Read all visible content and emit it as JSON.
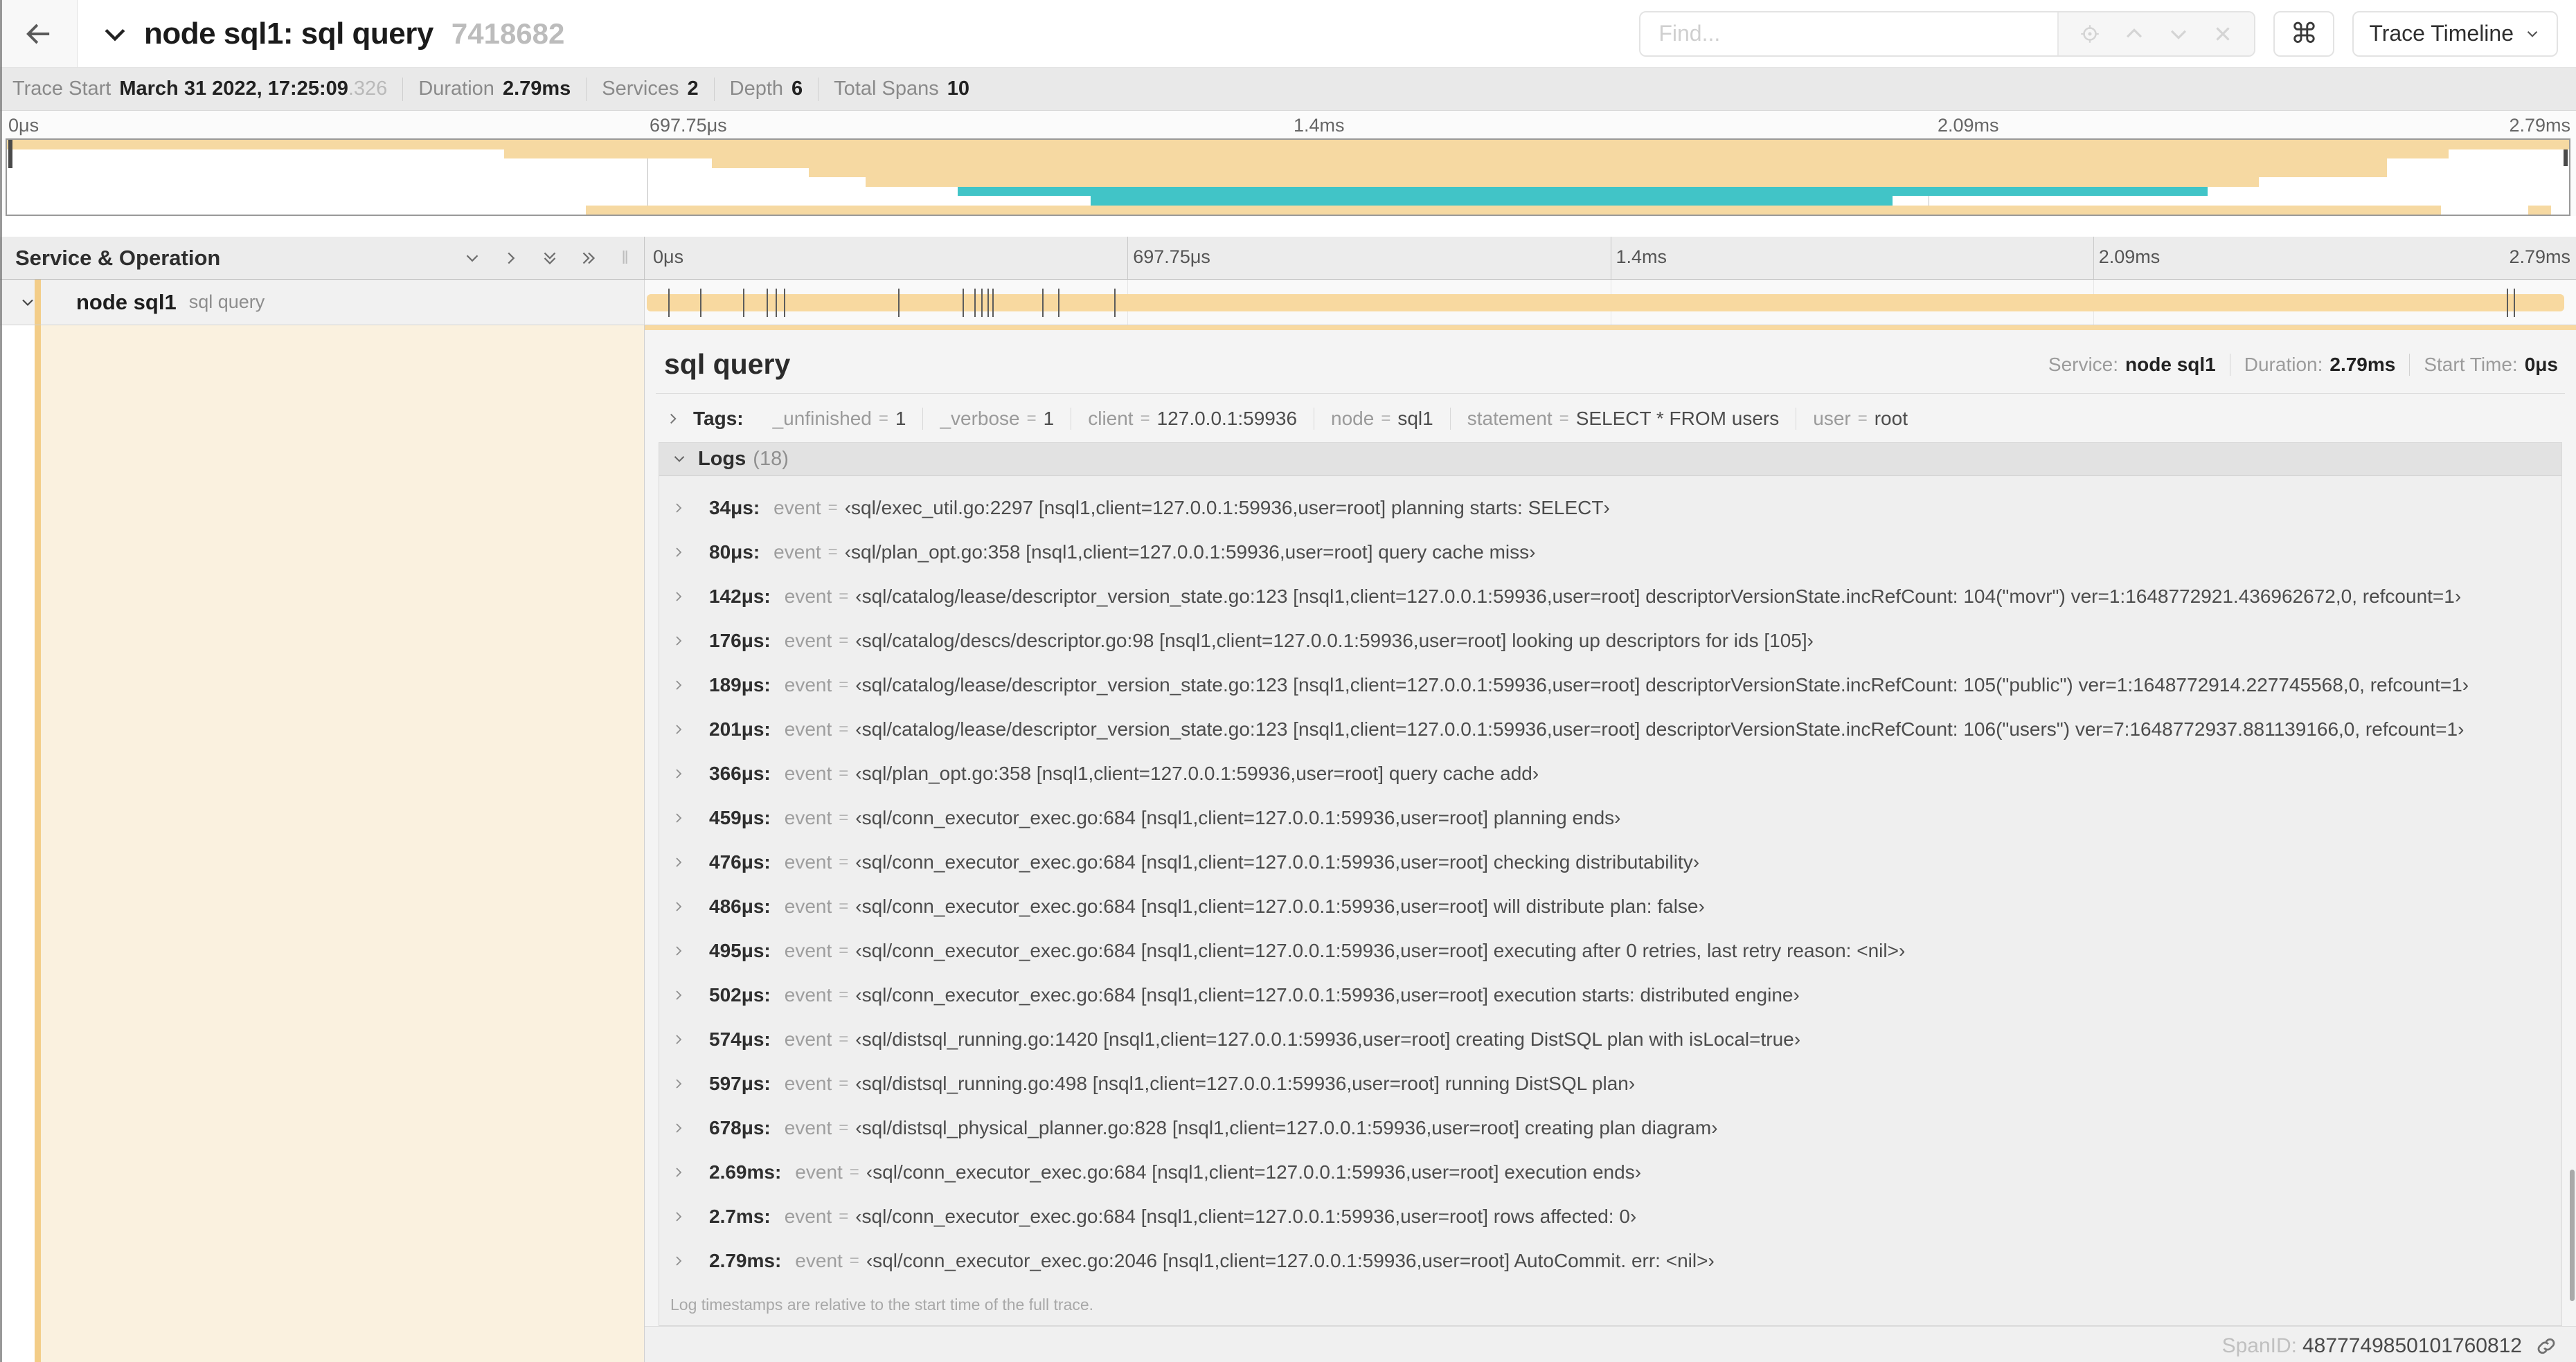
{
  "colors": {
    "tan_bar": "#f8d9a0",
    "tan_stripe": "#f3cd88",
    "tan_mini": "#f6d9a2",
    "teal": "#41c4c7",
    "cream": "#faf1df"
  },
  "header": {
    "title": "node sql1: sql query",
    "trace_id_short": "7418682",
    "find_placeholder": "Find...",
    "cmd_glyph": "⌘",
    "view_button_label": "Trace Timeline"
  },
  "trace_info": {
    "start_label": "Trace Start",
    "start_value": "March 31 2022, 17:25:09",
    "start_fraction": ".326",
    "items": [
      {
        "label": "Duration",
        "value": "2.79ms"
      },
      {
        "label": "Services",
        "value": "2"
      },
      {
        "label": "Depth",
        "value": "6"
      },
      {
        "label": "Total Spans",
        "value": "10"
      }
    ]
  },
  "timeline": {
    "ticks": [
      {
        "label": "0μs",
        "pct": 0
      },
      {
        "label": "697.75μs",
        "pct": 25
      },
      {
        "label": "1.4ms",
        "pct": 50
      },
      {
        "label": "2.09ms",
        "pct": 75
      },
      {
        "label": "2.79ms",
        "pct": 100
      }
    ],
    "gridline_pcts": [
      25,
      50,
      75
    ],
    "total_us": 2790
  },
  "minimap": {
    "rows": 8,
    "spans": [
      {
        "row": 0,
        "start": 0,
        "end": 100,
        "c": "tan"
      },
      {
        "row": 1,
        "start": 19.4,
        "end": 95.3,
        "c": "tan"
      },
      {
        "row": 2,
        "start": 27.5,
        "end": 92.9,
        "c": "tan"
      },
      {
        "row": 3,
        "start": 31.3,
        "end": 92.9,
        "c": "tan"
      },
      {
        "row": 4,
        "start": 33.5,
        "end": 87.9,
        "c": "tan"
      },
      {
        "row": 5,
        "start": 37.1,
        "end": 85.9,
        "c": "teal"
      },
      {
        "row": 6,
        "start": 42.3,
        "end": 73.6,
        "c": "teal"
      },
      {
        "row": 7,
        "start": 22.6,
        "end": 95.0,
        "c": "tan"
      },
      {
        "row": 7,
        "start": 98.4,
        "end": 99.3,
        "c": "tan"
      }
    ]
  },
  "service_operation": {
    "title": "Service & Operation"
  },
  "span_row": {
    "service": "node sql1",
    "operation": "sql query",
    "bar_start_pct": 0.1,
    "bar_end_pct": 99.4,
    "marker_times_us": [
      34,
      80,
      142,
      176,
      189,
      201,
      366,
      459,
      476,
      486,
      495,
      502,
      574,
      597,
      678,
      2690,
      2700
    ]
  },
  "detail": {
    "title": "sql query",
    "meta": [
      {
        "label": "Service:",
        "value": "node sql1"
      },
      {
        "label": "Duration:",
        "value": "2.79ms"
      },
      {
        "label": "Start Time:",
        "value": "0μs"
      }
    ],
    "tags_label": "Tags:",
    "tags": [
      {
        "key": "_unfinished",
        "value": "1"
      },
      {
        "key": "_verbose",
        "value": "1"
      },
      {
        "key": "client",
        "value": "127.0.0.1:59936"
      },
      {
        "key": "node",
        "value": "sql1"
      },
      {
        "key": "statement",
        "value": "SELECT * FROM users"
      },
      {
        "key": "user",
        "value": "root"
      }
    ],
    "logs_label": "Logs",
    "logs_count": "(18)",
    "logs": [
      {
        "time": "34μs",
        "key": "event",
        "value": "‹sql/exec_util.go:2297 [nsql1,client=127.0.0.1:59936,user=root] planning starts: SELECT›"
      },
      {
        "time": "80μs",
        "key": "event",
        "value": "‹sql/plan_opt.go:358 [nsql1,client=127.0.0.1:59936,user=root] query cache miss›"
      },
      {
        "time": "142μs",
        "key": "event",
        "value": "‹sql/catalog/lease/descriptor_version_state.go:123 [nsql1,client=127.0.0.1:59936,user=root] descriptorVersionState.incRefCount: 104(\"movr\") ver=1:1648772921.436962672,0, refcount=1›"
      },
      {
        "time": "176μs",
        "key": "event",
        "value": "‹sql/catalog/descs/descriptor.go:98 [nsql1,client=127.0.0.1:59936,user=root] looking up descriptors for ids [105]›"
      },
      {
        "time": "189μs",
        "key": "event",
        "value": "‹sql/catalog/lease/descriptor_version_state.go:123 [nsql1,client=127.0.0.1:59936,user=root] descriptorVersionState.incRefCount: 105(\"public\") ver=1:1648772914.227745568,0, refcount=1›"
      },
      {
        "time": "201μs",
        "key": "event",
        "value": "‹sql/catalog/lease/descriptor_version_state.go:123 [nsql1,client=127.0.0.1:59936,user=root] descriptorVersionState.incRefCount: 106(\"users\") ver=7:1648772937.881139166,0, refcount=1›"
      },
      {
        "time": "366μs",
        "key": "event",
        "value": "‹sql/plan_opt.go:358 [nsql1,client=127.0.0.1:59936,user=root] query cache add›"
      },
      {
        "time": "459μs",
        "key": "event",
        "value": "‹sql/conn_executor_exec.go:684 [nsql1,client=127.0.0.1:59936,user=root] planning ends›"
      },
      {
        "time": "476μs",
        "key": "event",
        "value": "‹sql/conn_executor_exec.go:684 [nsql1,client=127.0.0.1:59936,user=root] checking distributability›"
      },
      {
        "time": "486μs",
        "key": "event",
        "value": "‹sql/conn_executor_exec.go:684 [nsql1,client=127.0.0.1:59936,user=root] will distribute plan: false›"
      },
      {
        "time": "495μs",
        "key": "event",
        "value": "‹sql/conn_executor_exec.go:684 [nsql1,client=127.0.0.1:59936,user=root] executing after 0 retries, last retry reason: <nil>›"
      },
      {
        "time": "502μs",
        "key": "event",
        "value": "‹sql/conn_executor_exec.go:684 [nsql1,client=127.0.0.1:59936,user=root] execution starts: distributed engine›"
      },
      {
        "time": "574μs",
        "key": "event",
        "value": "‹sql/distsql_running.go:1420 [nsql1,client=127.0.0.1:59936,user=root] creating DistSQL plan with isLocal=true›"
      },
      {
        "time": "597μs",
        "key": "event",
        "value": "‹sql/distsql_running.go:498 [nsql1,client=127.0.0.1:59936,user=root] running DistSQL plan›"
      },
      {
        "time": "678μs",
        "key": "event",
        "value": "‹sql/distsql_physical_planner.go:828 [nsql1,client=127.0.0.1:59936,user=root] creating plan diagram›"
      },
      {
        "time": "2.69ms",
        "key": "event",
        "value": "‹sql/conn_executor_exec.go:684 [nsql1,client=127.0.0.1:59936,user=root] execution ends›"
      },
      {
        "time": "2.7ms",
        "key": "event",
        "value": "‹sql/conn_executor_exec.go:684 [nsql1,client=127.0.0.1:59936,user=root] rows affected: 0›"
      },
      {
        "time": "2.79ms",
        "key": "event",
        "value": "‹sql/conn_executor_exec.go:2046 [nsql1,client=127.0.0.1:59936,user=root] AutoCommit. err: <nil>›"
      }
    ],
    "note": "Log timestamps are relative to the start time of the full trace.",
    "spanid_label": "SpanID:",
    "spanid_value": "4877749850101760812"
  }
}
